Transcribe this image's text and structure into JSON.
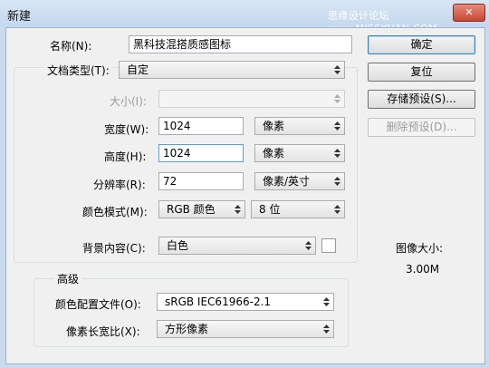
{
  "window": {
    "title": "新建",
    "watermark": "思缘设计论坛 www.MISSYUAN.COM",
    "close_glyph": "✕"
  },
  "form": {
    "name": {
      "label": "名称(N):",
      "value": "黑科技混搭质感图标"
    },
    "preset": {
      "label": "文档类型(T):",
      "value": "自定"
    },
    "size": {
      "label": "大小(I):",
      "value": ""
    },
    "width": {
      "label": "宽度(W):",
      "value": "1024",
      "unit": "像素"
    },
    "height": {
      "label": "高度(H):",
      "value": "1024",
      "unit": "像素"
    },
    "resolution": {
      "label": "分辨率(R):",
      "value": "72",
      "unit": "像素/英寸"
    },
    "color_mode": {
      "label": "颜色模式(M):",
      "mode": "RGB 颜色",
      "depth": "8 位"
    },
    "background": {
      "label": "背景内容(C):",
      "value": "白色"
    },
    "advanced": {
      "title": "高级",
      "color_profile": {
        "label": "颜色配置文件(O):",
        "value": "sRGB IEC61966-2.1"
      },
      "pixel_aspect": {
        "label": "像素长宽比(X):",
        "value": "方形像素"
      }
    }
  },
  "buttons": {
    "ok": "确定",
    "reset": "复位",
    "save_preset": "存储预设(S)...",
    "delete_preset": "删除预设(D)..."
  },
  "image_size": {
    "label": "图像大小:",
    "value": "3.00M"
  },
  "colors": {
    "accent": "#3c7fb1",
    "titlebar": "#c9dbef",
    "close": "#c74632"
  }
}
